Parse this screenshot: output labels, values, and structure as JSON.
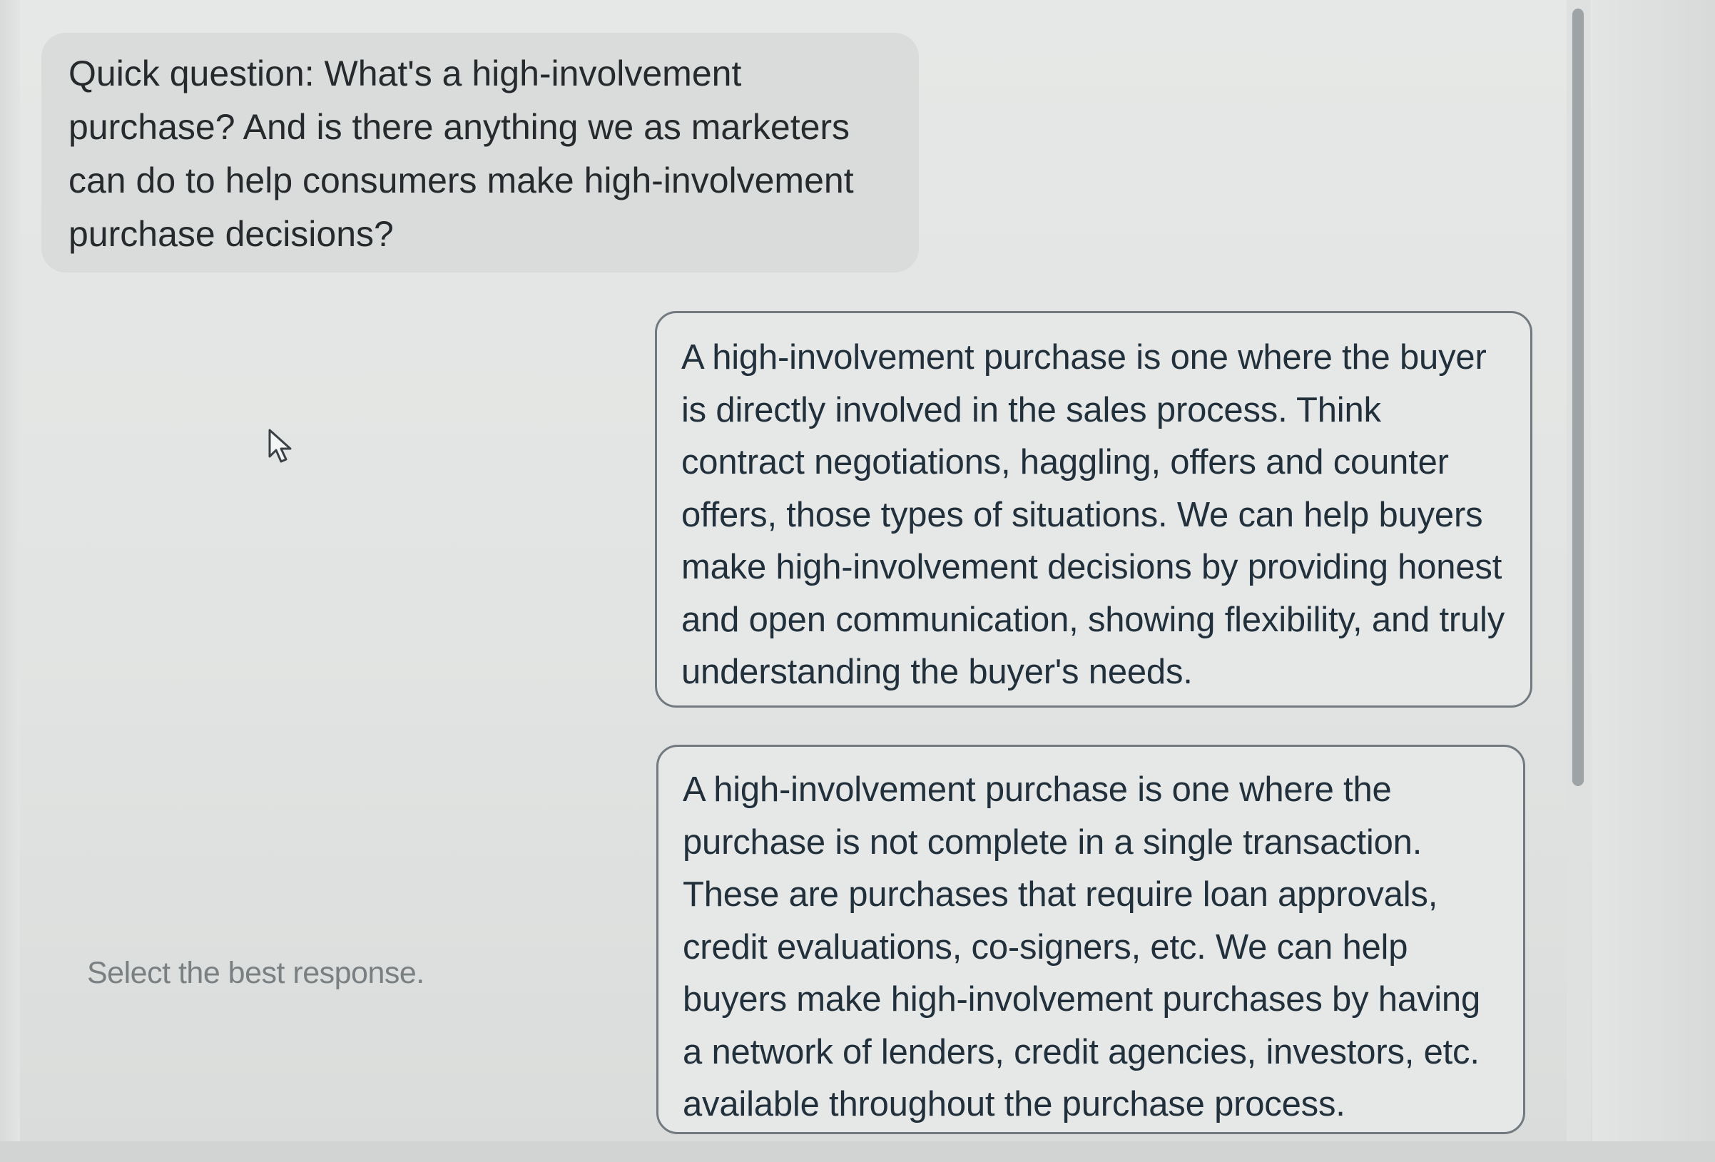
{
  "question": {
    "text": "Quick question: What's a high-involvement purchase? And is there anything we as marketers can do to help consumers make high-involvement purchase decisions?"
  },
  "instruction": {
    "text": "Select the best response."
  },
  "options": [
    {
      "text": "A high-involvement purchase is one where the buyer is directly involved in the sales process. Think contract negotiations, haggling, offers and counter offers, those types of situations. We can help buyers make high-involvement decisions by providing honest and open communication, showing flexibility, and truly understanding the buyer's needs."
    },
    {
      "text": "A high-involvement purchase is one where the purchase is not complete in a single transaction. These are purchases that require loan approvals, credit evaluations, co-signers, etc. We can help buyers make high-involvement purchases by having a network of lenders, credit agencies, investors, etc. available throughout the purchase process."
    }
  ],
  "icons": {
    "cursor": "mouse-pointer-icon"
  },
  "colors": {
    "question_bubble": "#d9dcdb",
    "option_border": "#727a7f",
    "option_text": "#22303c",
    "hint_text": "#7a7f82"
  }
}
